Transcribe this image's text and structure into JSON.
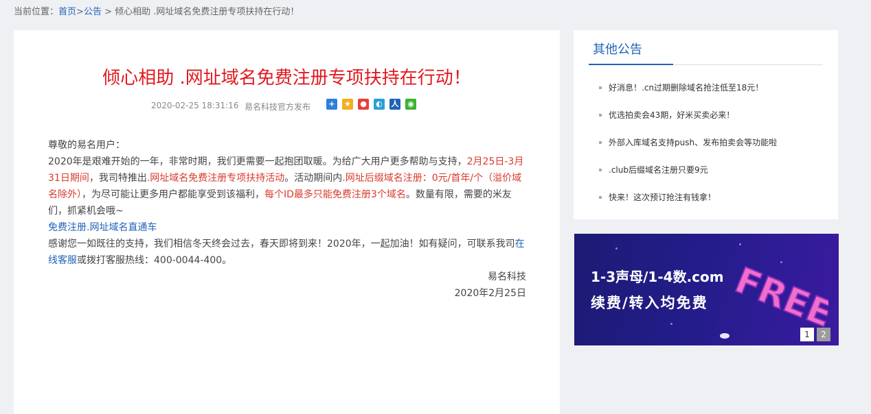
{
  "breadcrumb": {
    "prefix": "当前位置：",
    "home": "首页",
    "sep1": ">",
    "section": "公告",
    "sep2": " > ",
    "current": "倾心相助 .网址域名免费注册专项扶持在行动！"
  },
  "article": {
    "title": "倾心相助 .网址域名免费注册专项扶持在行动！",
    "date": "2020-02-25 18:31:16",
    "publisher": "易名科技官方发布",
    "share_icons": [
      "share-plus-icon",
      "qzone-icon",
      "weibo-icon",
      "tencent-icon",
      "renren-icon",
      "wechat-icon"
    ],
    "greeting": "尊敬的易名用户：",
    "p1_a": "2020年是艰难开始的一年，非常时期，我们更需要一起抱团取暖。为给广大用户更多帮助与支持，",
    "p1_red1": "2月25日-3月31日期间",
    "p1_b": "，我司特推出",
    "p1_red2": ".网址域名免费注册专项扶持活动",
    "p1_c": "。活动期间内",
    "p1_red3": ".网址后缀域名注册：0元/首年/个（溢价域名除外）",
    "p1_d": "，为尽可能让更多用户都能享受到该福利，",
    "p1_red4": "每个ID最多只能免费注册3个域名",
    "p1_e": "。数量有限，需要的米友们，抓紧机会哦~",
    "link_text": "免费注册.网址域名直通车",
    "p2_a": "感谢您一如既往的支持，我们相信冬天终会过去，春天即将到来！2020年，一起加油！如有疑问，可联系我司",
    "p2_link": "在线客服",
    "p2_b": "或拨打客服热线：400-0044-400。",
    "sign_company": "易名科技",
    "sign_date": "2020年2月25日"
  },
  "sidebar": {
    "title": "其他公告",
    "items": [
      "好消息！.cn过期删除域名抢注低至18元！",
      "优选拍卖会43期，好米买卖必来！",
      "外部入库域名支持push、发布拍卖会等功能啦",
      ".club后缀域名注册只要9元",
      "快来！这次预订抢注有钱拿！"
    ]
  },
  "banner": {
    "line1": "1-3声母/1-4数.com",
    "line2": "续费/转入均免费",
    "art_text": "FREE",
    "pages": [
      "1",
      "2"
    ],
    "active_page": 1
  },
  "colors": {
    "accent_blue": "#1f63b9",
    "title_red": "#e1181f",
    "highlight_red": "#d93a2b",
    "page_bg": "#eff0f4"
  }
}
